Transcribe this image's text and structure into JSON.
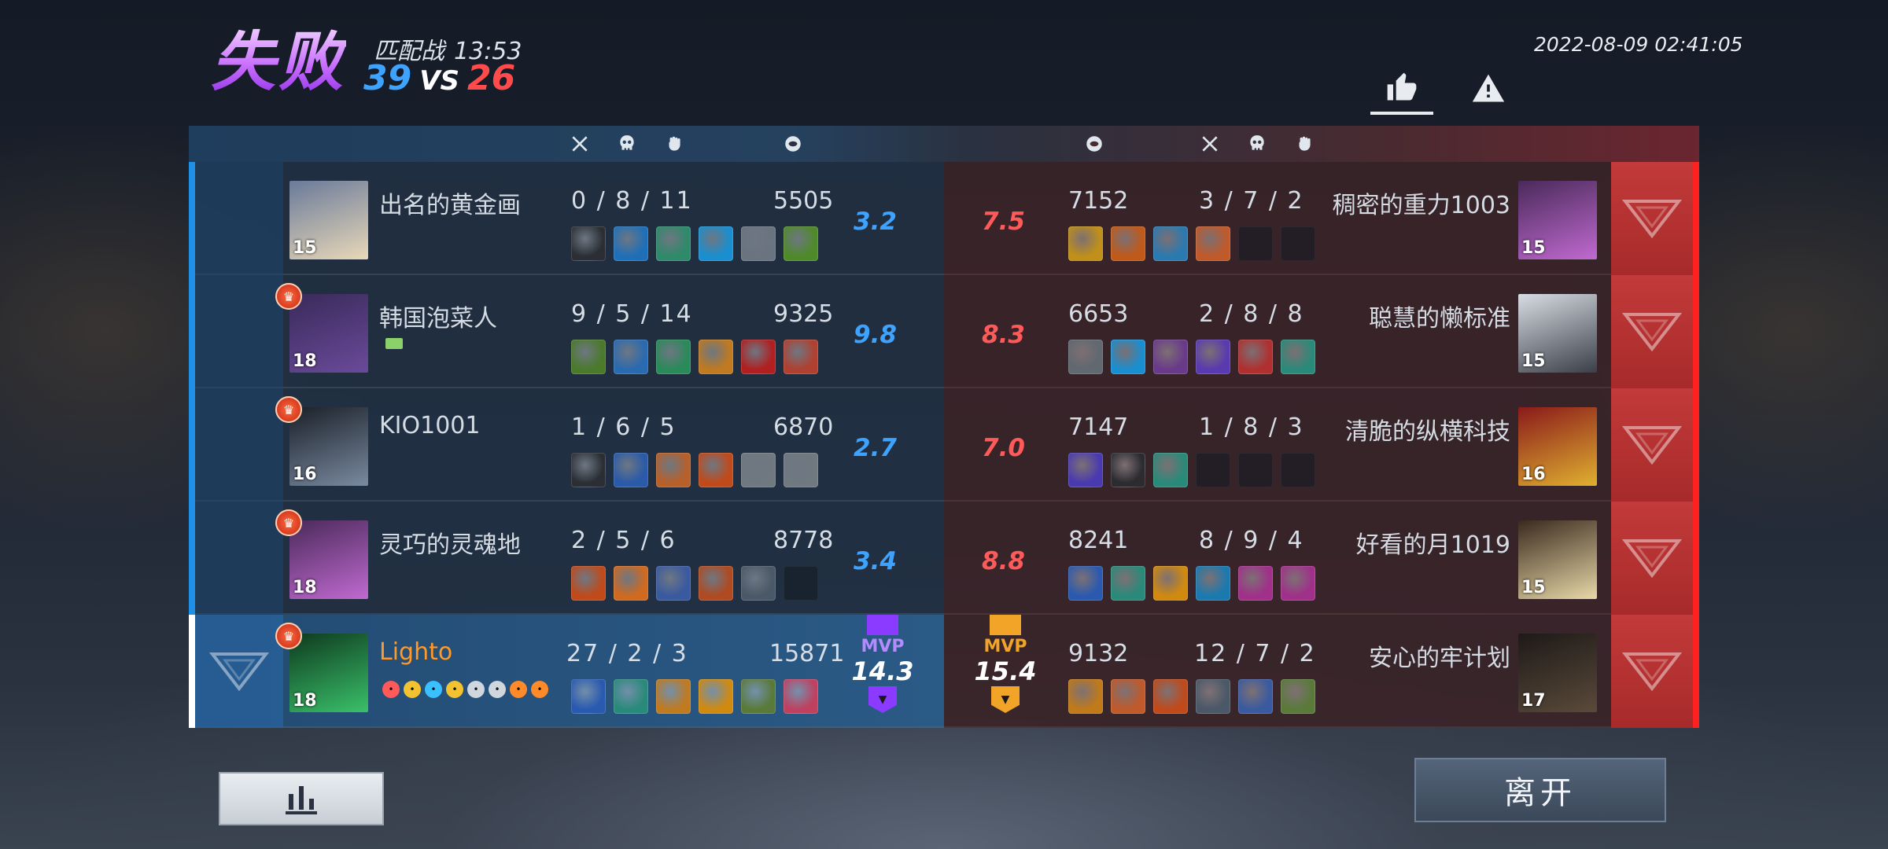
{
  "header": {
    "result": "失败",
    "mode": "匹配战",
    "duration": "13:53",
    "score_blue": "39",
    "vs": "VS",
    "score_red": "26",
    "timestamp": "2022-08-09 02:41:05",
    "like_icon": "thumbs-up-icon",
    "report_icon": "warning-icon"
  },
  "column_icons": {
    "kills": "crossed-swords-icon",
    "deaths": "skull-icon",
    "assists": "fist-icon",
    "gold": "coin-icon"
  },
  "colors": {
    "blue_team": "#1e90e8",
    "red_team": "#ff2020",
    "mvp_blue": "#8a3bff",
    "mvp_red": "#f2a428",
    "my_name": "#ff9a2a"
  },
  "blue_team": [
    {
      "name": "出名的黄金画",
      "level": "15",
      "kda": "0 / 8 / 11",
      "gold": "5505",
      "rating": "3.2",
      "crown": false,
      "items": [
        "#2b2f35",
        "#1f6fb8",
        "#2e8a6a",
        "#1a8fd0",
        "#6a7480",
        "#4f8a2a"
      ]
    },
    {
      "name": "韩国泡菜人",
      "level": "18",
      "kda": "9 / 5 / 14",
      "gold": "9325",
      "rating": "9.8",
      "crown": true,
      "items": [
        "#4a7a2a",
        "#2a6ab0",
        "#2a8a5a",
        "#c07a20",
        "#b02020",
        "#b04030"
      ]
    },
    {
      "name": "KIO1001",
      "level": "16",
      "kda": "1 / 6 / 5",
      "gold": "6870",
      "rating": "2.7",
      "crown": true,
      "items": [
        "#2b2f35",
        "#2a5aa8",
        "#b8602a",
        "#c04a1a",
        "#707880",
        "#707880"
      ]
    },
    {
      "name": "灵巧的灵魂地",
      "level": "18",
      "kda": "2 / 5 / 6",
      "gold": "8778",
      "rating": "3.4",
      "crown": true,
      "items": [
        "#c04a1a",
        "#d06a20",
        "#3a5aa0",
        "#b04a20",
        "#4a5868",
        "empty"
      ]
    },
    {
      "name": "Lighto",
      "level": "18",
      "kda": "27 / 2 / 3",
      "gold": "15871",
      "rating": "14.3",
      "crown": true,
      "mvp": "MVP",
      "items": [
        "#2a5ab0",
        "#2a8a7a",
        "#c07a20",
        "#d08a10",
        "#5a7a3a",
        "#c04060"
      ],
      "tags": [
        "#ff5a5a",
        "#f2c230",
        "#3ac0ff",
        "#f2c230",
        "#d0d6de",
        "#d0d6de",
        "#ff8a2a",
        "#ff8a2a"
      ]
    }
  ],
  "red_team": [
    {
      "name": "稠密的重力1003",
      "level": "15",
      "kda": "3 / 7 / 2",
      "gold": "7152",
      "rating": "7.5",
      "items": [
        "#c0901a",
        "#c05a1a",
        "#2a7ab0",
        "#c05a2a",
        "empty",
        "empty"
      ]
    },
    {
      "name": "聪慧的懒标准",
      "level": "15",
      "kda": "2 / 8 / 8",
      "gold": "6653",
      "rating": "8.3",
      "items": [
        "#606870",
        "#1a8fd0",
        "#6a3a8a",
        "#5a3ab0",
        "#b03030",
        "#2a8a7a"
      ]
    },
    {
      "name": "清脆的纵横科技",
      "level": "16",
      "kda": "1 / 8 / 3",
      "gold": "7147",
      "rating": "7.0",
      "items": [
        "#4a3ab0",
        "#2b2b30",
        "#2a8a7a",
        "empty",
        "empty",
        "empty"
      ]
    },
    {
      "name": "好看的月1019",
      "level": "15",
      "kda": "8 / 9 / 4",
      "gold": "8241",
      "rating": "8.8",
      "items": [
        "#2a5ab0",
        "#2a8a7a",
        "#d08a10",
        "#1a7ab0",
        "#a0308a",
        "#a0308a"
      ]
    },
    {
      "name": "安心的牢计划",
      "level": "17",
      "kda": "12 / 7 / 2",
      "gold": "9132",
      "rating": "15.4",
      "mvp": "MVP",
      "items": [
        "#c07a1a",
        "#c05a2a",
        "#c04a1a",
        "#4a5868",
        "#3a5aa0",
        "#5a7a3a"
      ]
    }
  ],
  "buttons": {
    "stats_icon": "bar-chart-icon",
    "leave": "离开"
  }
}
